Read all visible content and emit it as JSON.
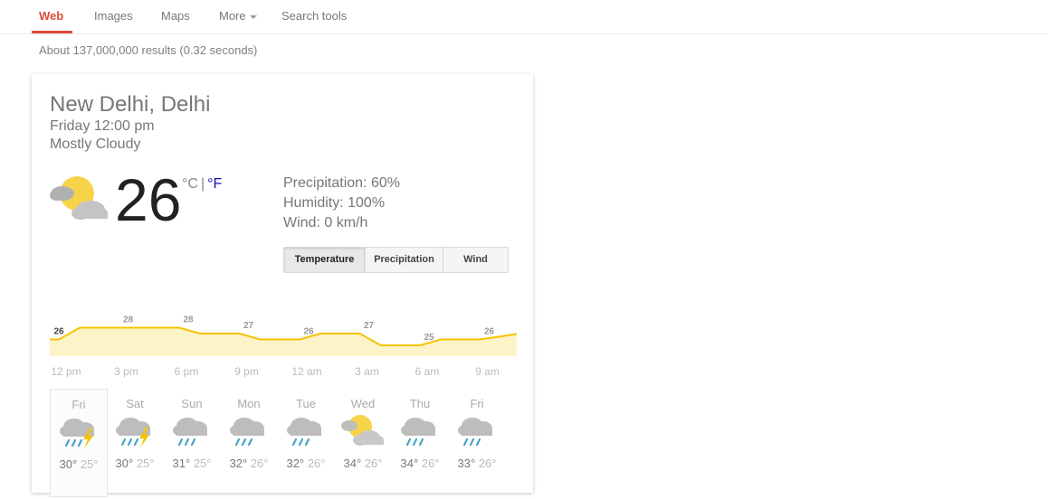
{
  "nav": {
    "web": "Web",
    "images": "Images",
    "maps": "Maps",
    "more": "More",
    "search_tools": "Search tools"
  },
  "result_stats": "About 137,000,000 results (0.32 seconds)",
  "weather": {
    "location": "New Delhi, Delhi",
    "time": "Friday 12:00 pm",
    "condition": "Mostly Cloudy",
    "temperature": "26",
    "unit_c": "°C",
    "unit_sep": "|",
    "unit_f": "°F",
    "precipitation": "Precipitation: 60%",
    "humidity": "Humidity: 100%",
    "wind": "Wind: 0 km/h",
    "current_icon": "partly-cloudy-icon",
    "tabs": [
      "Temperature",
      "Precipitation",
      "Wind"
    ],
    "active_tab": "Temperature",
    "accent_color": "#f5c400",
    "fill_color": "#fdf3c8"
  },
  "chart_data": {
    "type": "area",
    "x": [
      "12 pm",
      "3 pm",
      "6 pm",
      "9 pm",
      "12 am",
      "3 am",
      "6 am",
      "9 am"
    ],
    "values": [
      26,
      28,
      28,
      27,
      26,
      27,
      25,
      26
    ],
    "labels": [
      "26",
      "28",
      "28",
      "27",
      "26",
      "27",
      "25",
      "26"
    ]
  },
  "forecast": [
    {
      "day": "Fri",
      "hi": "30°",
      "lo": "25°",
      "icon": "thunderstorm-icon",
      "selected": true
    },
    {
      "day": "Sat",
      "hi": "30°",
      "lo": "25°",
      "icon": "thunderstorm-icon"
    },
    {
      "day": "Sun",
      "hi": "31°",
      "lo": "25°",
      "icon": "rain-icon"
    },
    {
      "day": "Mon",
      "hi": "32°",
      "lo": "26°",
      "icon": "rain-icon"
    },
    {
      "day": "Tue",
      "hi": "32°",
      "lo": "26°",
      "icon": "rain-icon"
    },
    {
      "day": "Wed",
      "hi": "34°",
      "lo": "26°",
      "icon": "partly-cloudy-icon"
    },
    {
      "day": "Thu",
      "hi": "34°",
      "lo": "26°",
      "icon": "rain-icon"
    },
    {
      "day": "Fri",
      "hi": "33°",
      "lo": "26°",
      "icon": "rain-icon"
    }
  ]
}
